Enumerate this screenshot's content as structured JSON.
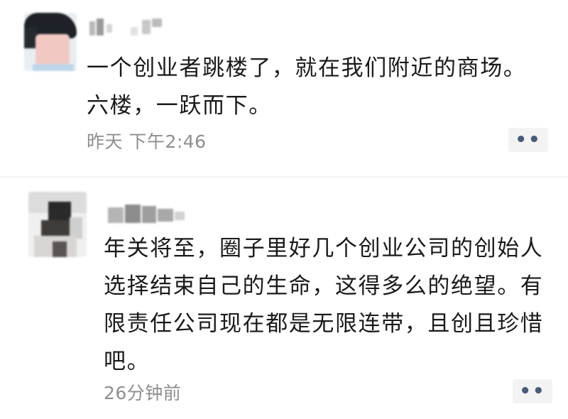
{
  "posts": [
    {
      "content": "一个创业者跳楼了，就在我们附近的商场。六楼，一跃而下。",
      "timestamp": "昨天 下午2:46",
      "more_icon": "••"
    },
    {
      "content": "年关将至，圈子里好几个创业公司的创始人选择结束自己的生命，这得多么的绝望。有限责任公司现在都是无限连带，且创且珍惜吧。",
      "timestamp": "26分钟前",
      "more_icon": "••"
    }
  ],
  "colors": {
    "text": "#1a1a1a",
    "timestamp": "#8e8e8e",
    "more_dots": "#4a5b7a",
    "more_bg": "#f3f3f3"
  },
  "icons": {
    "more": "more-dots-icon"
  }
}
